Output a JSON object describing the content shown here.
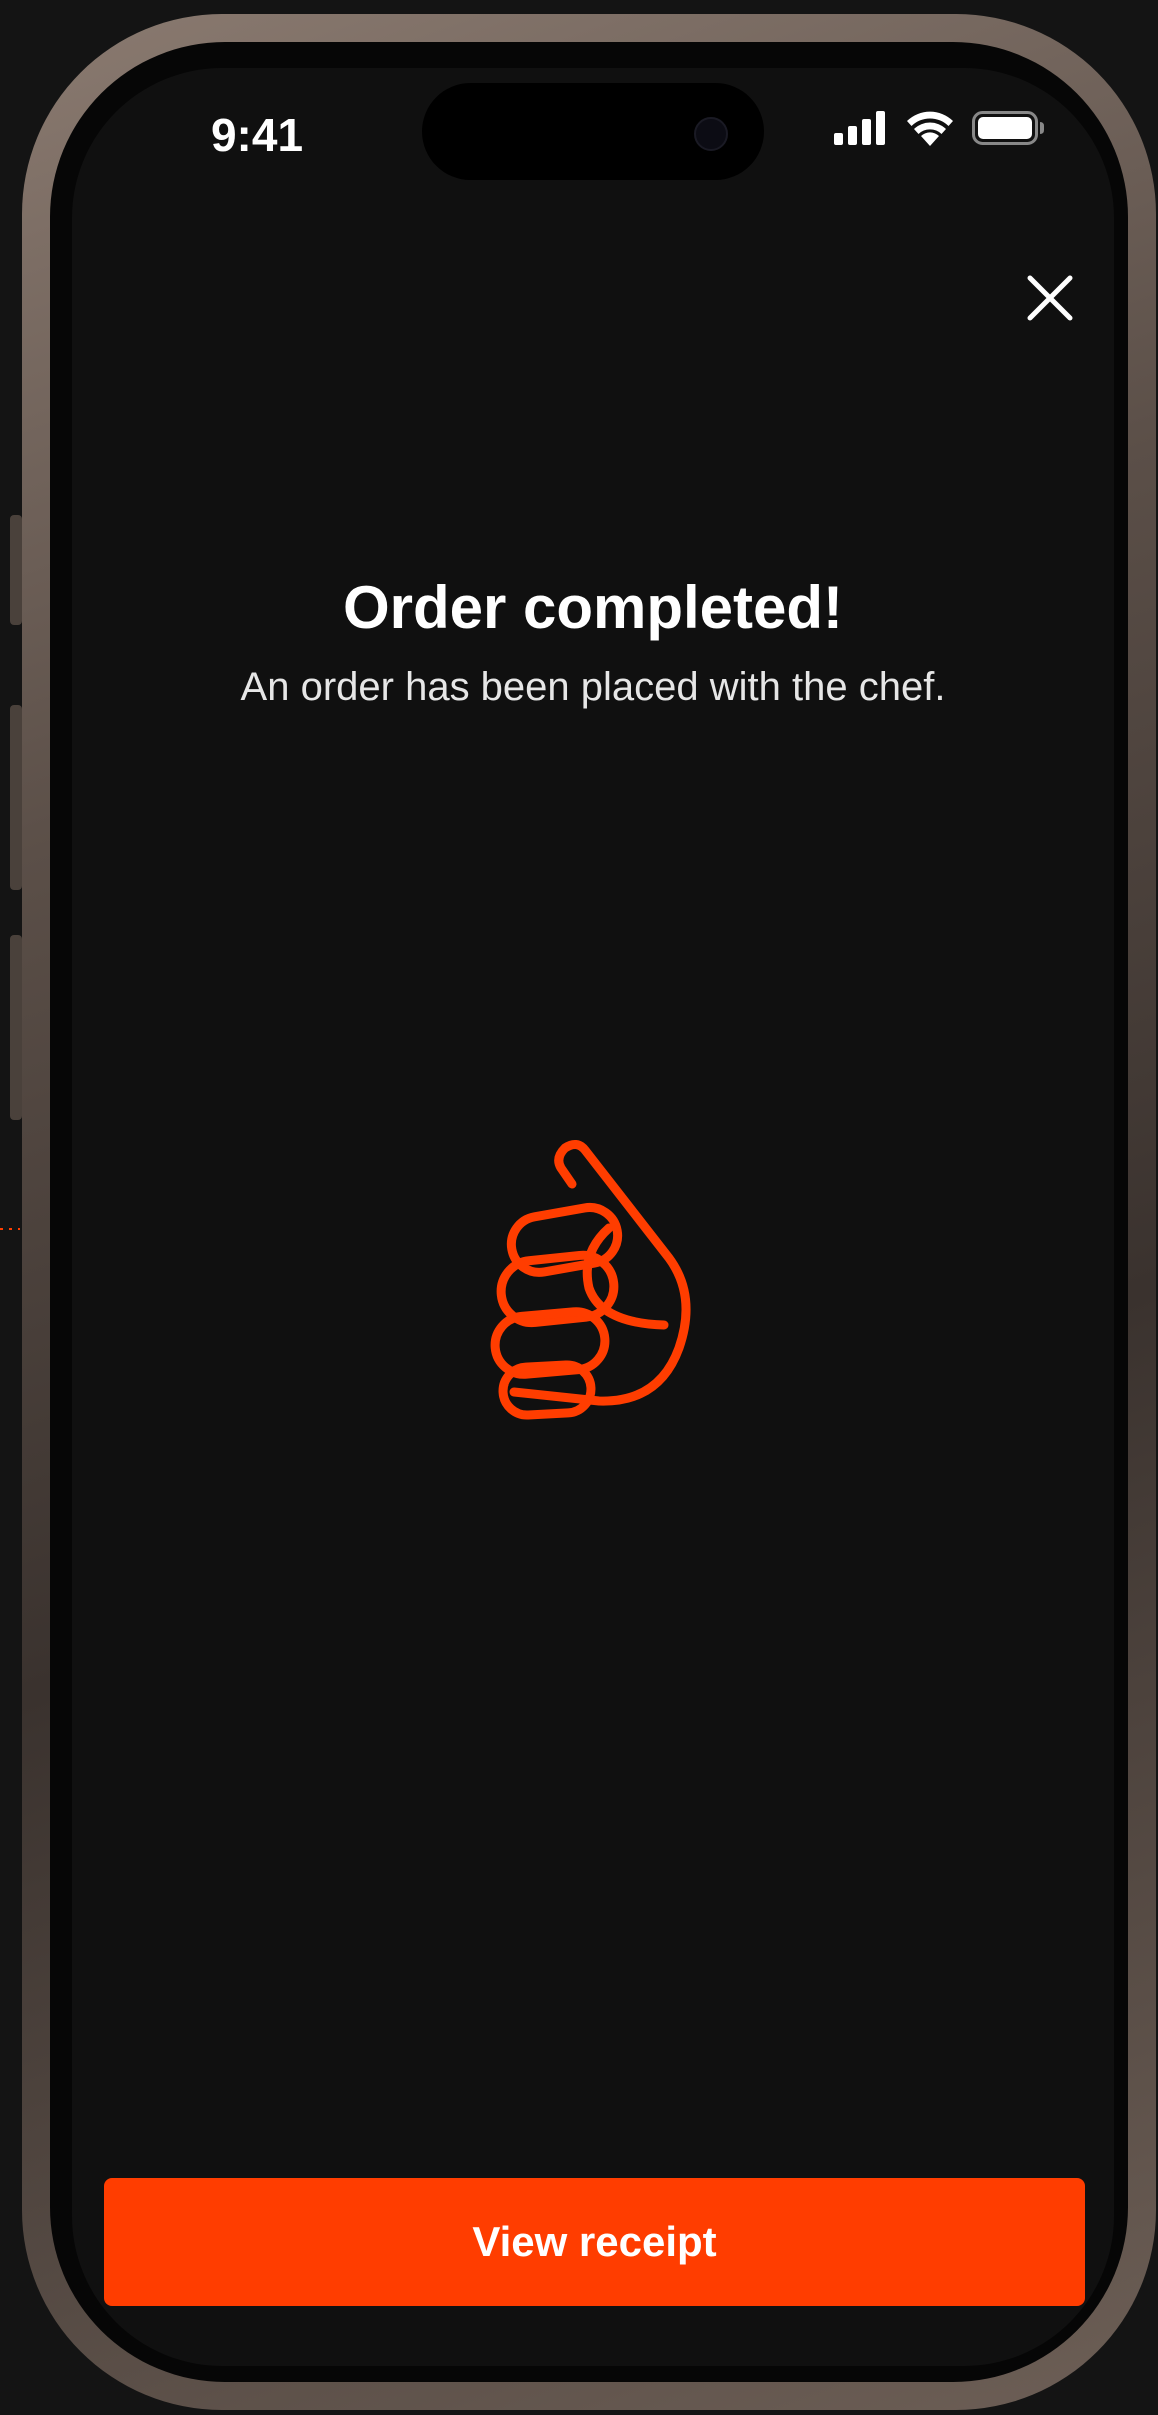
{
  "status_bar": {
    "time": "9:41",
    "signal_icon": "cellular-signal-icon",
    "wifi_icon": "wifi-icon",
    "battery_icon": "battery-icon"
  },
  "header": {
    "close_icon": "close-icon"
  },
  "main": {
    "title": "Order completed!",
    "subtitle": "An order has been placed with the chef.",
    "illustration": "thumbs-up-icon"
  },
  "footer": {
    "view_receipt_label": "View receipt"
  },
  "colors": {
    "background": "#101010",
    "accent": "#ff3d00",
    "text_primary": "#ffffff",
    "text_secondary": "#e6e6e6"
  }
}
